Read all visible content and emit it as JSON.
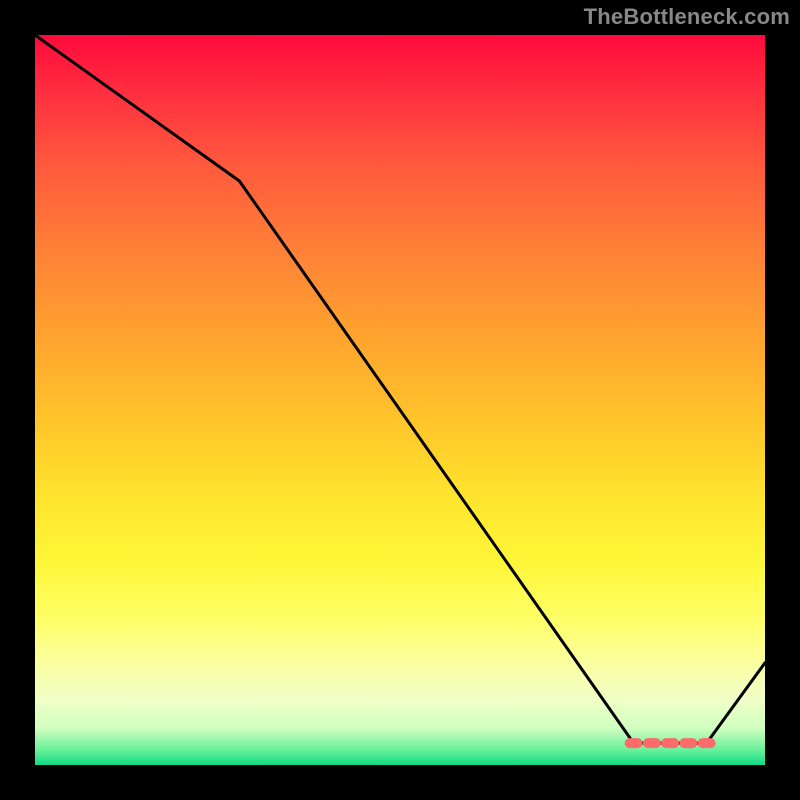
{
  "attribution": "TheBottleneck.com",
  "chart_data": {
    "type": "line",
    "title": "",
    "xlabel": "",
    "ylabel": "",
    "xlim": [
      0,
      100
    ],
    "ylim": [
      0,
      100
    ],
    "grid": false,
    "legend": false,
    "line": {
      "color": "#000000",
      "x": [
        0,
        28,
        82,
        92,
        100
      ],
      "values": [
        100,
        80,
        3,
        3,
        14
      ]
    },
    "markers": {
      "color": "#ff6a6a",
      "shape": "rounded-rect",
      "x": [
        82,
        84.5,
        87,
        89.5,
        92
      ],
      "values": [
        3,
        3,
        3,
        3,
        3
      ]
    },
    "gradient_stops": [
      {
        "pos": 0,
        "color": "#ff0a3c"
      },
      {
        "pos": 8,
        "color": "#ff2f3f"
      },
      {
        "pos": 18,
        "color": "#ff5a3d"
      },
      {
        "pos": 30,
        "color": "#ff8236"
      },
      {
        "pos": 42,
        "color": "#ffa52e"
      },
      {
        "pos": 54,
        "color": "#ffc82a"
      },
      {
        "pos": 64,
        "color": "#ffe62e"
      },
      {
        "pos": 72,
        "color": "#fff638"
      },
      {
        "pos": 80,
        "color": "#feff66"
      },
      {
        "pos": 86,
        "color": "#fbffa0"
      },
      {
        "pos": 91,
        "color": "#f1ffc8"
      },
      {
        "pos": 95,
        "color": "#cfffbf"
      },
      {
        "pos": 98,
        "color": "#67f09a"
      },
      {
        "pos": 100,
        "color": "#11da85"
      }
    ]
  }
}
